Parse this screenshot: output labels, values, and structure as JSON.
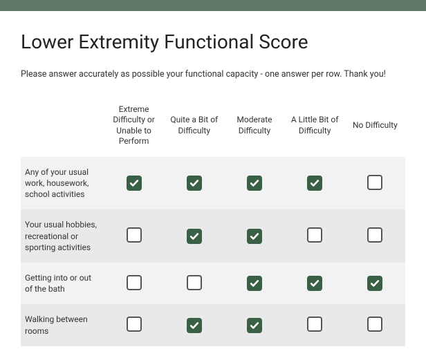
{
  "title": "Lower Extremity Functional Score",
  "instructions": "Please answer accurately as possible your functional capacity  - one answer per row. Thank you!",
  "columns": [
    "Extreme Difficulty or Unable to Perform",
    "Quite a Bit of Difficulty",
    "Moderate Difficulty",
    "A Little Bit of Difficulty",
    "No Difficulty"
  ],
  "rows": [
    {
      "label": "Any of your usual work, housework, school activities",
      "values": [
        true,
        true,
        true,
        true,
        false
      ]
    },
    {
      "label": "Your usual hobbies, recreational or sporting activities",
      "values": [
        false,
        true,
        true,
        false,
        false
      ]
    },
    {
      "label": "Getting into or out of the bath",
      "values": [
        false,
        false,
        true,
        true,
        true
      ]
    },
    {
      "label": "Walking between rooms",
      "values": [
        false,
        true,
        true,
        false,
        false
      ]
    }
  ]
}
